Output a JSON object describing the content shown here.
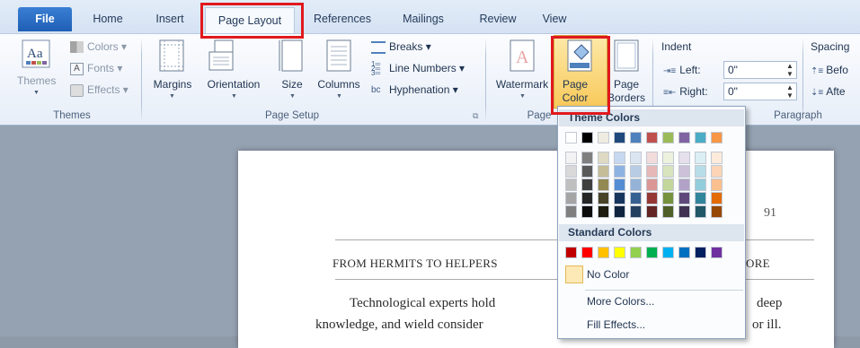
{
  "tabs": {
    "file": "File",
    "home": "Home",
    "insert": "Insert",
    "page_layout": "Page Layout",
    "references": "References",
    "mailings": "Mailings",
    "review": "Review",
    "view": "View"
  },
  "themes_group": {
    "themes": "Themes",
    "colors": "Colors",
    "fonts": "Fonts",
    "effects": "Effects",
    "label": "Themes"
  },
  "page_setup": {
    "margins": "Margins",
    "orientation": "Orientation",
    "size": "Size",
    "columns": "Columns",
    "breaks": "Breaks",
    "line_numbers": "Line Numbers",
    "hyphenation": "Hyphenation",
    "label": "Page Setup"
  },
  "page_background": {
    "watermark": "Watermark",
    "page_color_1": "Page",
    "page_color_2": "Color",
    "page_borders_1": "Page",
    "page_borders_2": "Borders",
    "label": "Page"
  },
  "paragraph": {
    "indent": "Indent",
    "left": "Left:",
    "left_value": "0\"",
    "right": "Right:",
    "right_value": "0\"",
    "spacing": "Spacing",
    "before": "Befo",
    "after": "Afte",
    "label": "Paragraph"
  },
  "dropdown": {
    "theme_colors": "Theme Colors",
    "standard_colors": "Standard Colors",
    "no_color": "No Color",
    "more_colors": "More Colors...",
    "fill_effects": "Fill Effects...",
    "theme_base": [
      "#ffffff",
      "#000000",
      "#eeece1",
      "#1f497d",
      "#4f81bd",
      "#c0504d",
      "#9bbb59",
      "#8064a2",
      "#4bacc6",
      "#f79646"
    ],
    "theme_shades": [
      [
        "#f2f2f2",
        "#d8d8d8",
        "#bfbfbf",
        "#a5a5a5",
        "#7f7f7f"
      ],
      [
        "#7f7f7f",
        "#595959",
        "#3f3f3f",
        "#262626",
        "#0c0c0c"
      ],
      [
        "#ddd9c3",
        "#c4bd97",
        "#938953",
        "#494429",
        "#1d1b10"
      ],
      [
        "#c6d9f0",
        "#8db3e2",
        "#548dd4",
        "#17365d",
        "#0f243e"
      ],
      [
        "#dbe5f1",
        "#b8cce4",
        "#95b3d7",
        "#366092",
        "#244061"
      ],
      [
        "#f2dcdb",
        "#e5b9b7",
        "#d99694",
        "#953734",
        "#632423"
      ],
      [
        "#ebf1dd",
        "#d7e3bc",
        "#c3d69b",
        "#76923c",
        "#4f6128"
      ],
      [
        "#e5e0ec",
        "#ccc1d9",
        "#b2a2c7",
        "#5f497a",
        "#3f3151"
      ],
      [
        "#dbeef3",
        "#b7dde8",
        "#92cddc",
        "#31859b",
        "#205867"
      ],
      [
        "#fdeada",
        "#fbd5b5",
        "#fac08f",
        "#e36c09",
        "#974806"
      ]
    ],
    "standard": [
      "#c00000",
      "#ff0000",
      "#ffc000",
      "#ffff00",
      "#92d050",
      "#00b050",
      "#00b0f0",
      "#0070c0",
      "#002060",
      "#7030a0"
    ]
  },
  "document": {
    "page_number": "91",
    "running_head_left": "FROM HERMITS TO HELPERS",
    "running_head_right": "ORE",
    "line1_left": "Technological   experts   hold",
    "line1_right": "deep",
    "line2_left": "knowledge,  and  wield  consider",
    "line2_right": "or  ill."
  }
}
